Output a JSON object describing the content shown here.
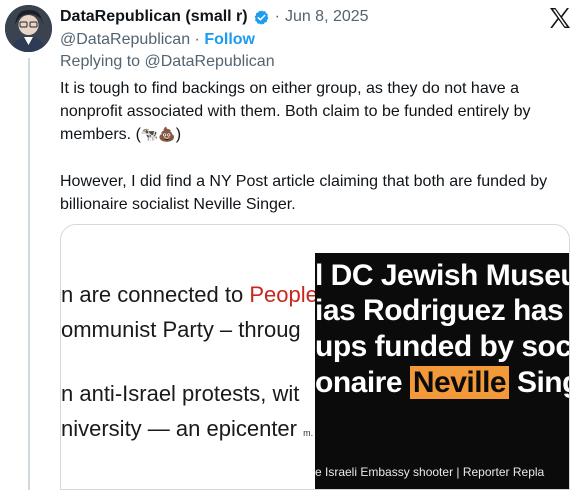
{
  "author": {
    "display_name": "DataRepublican (small r)",
    "handle": "@DataRepublican",
    "date": "Jun 8, 2025",
    "follow_label": "Follow",
    "dot_separator": "·"
  },
  "reply": {
    "label": "Replying to @DataRepublican"
  },
  "tweet": {
    "paragraph1": "It is tough to find backings on either group, as they do not have a nonprofit associated with them. Both claim to be funded entirely by members. (",
    "paragraph1_emoji": "🐄💩",
    "paragraph1_end": ")",
    "paragraph2": "However, I did find a NY Post article claiming that both are funded by billionaire socialist Neville Singer."
  },
  "media": {
    "left_image": {
      "line1_a": "n are connected to ",
      "line1_b": "People",
      "line2": "ommunist Party – throug",
      "line3": "n anti-Israel protests, wit",
      "line4": "niversity — an epicenter",
      "line4_small": "m. ET"
    },
    "right_image": {
      "line1": "l DC Jewish Museu",
      "line2": "ias Rodriguez has",
      "line3": "ups funded by soc",
      "line4_a": "onaire ",
      "line4_b": "Neville",
      "line4_c": " Sing",
      "caption": "e Israeli Embassy shooter | Reporter Repla"
    }
  },
  "icons": {
    "verified": "verified-badge-icon",
    "x_logo": "x-logo-icon"
  },
  "colors": {
    "accent": "#1d9bf0",
    "secondary_text": "#536471",
    "highlight": "#f29a3a",
    "red_text": "#c9261c"
  }
}
